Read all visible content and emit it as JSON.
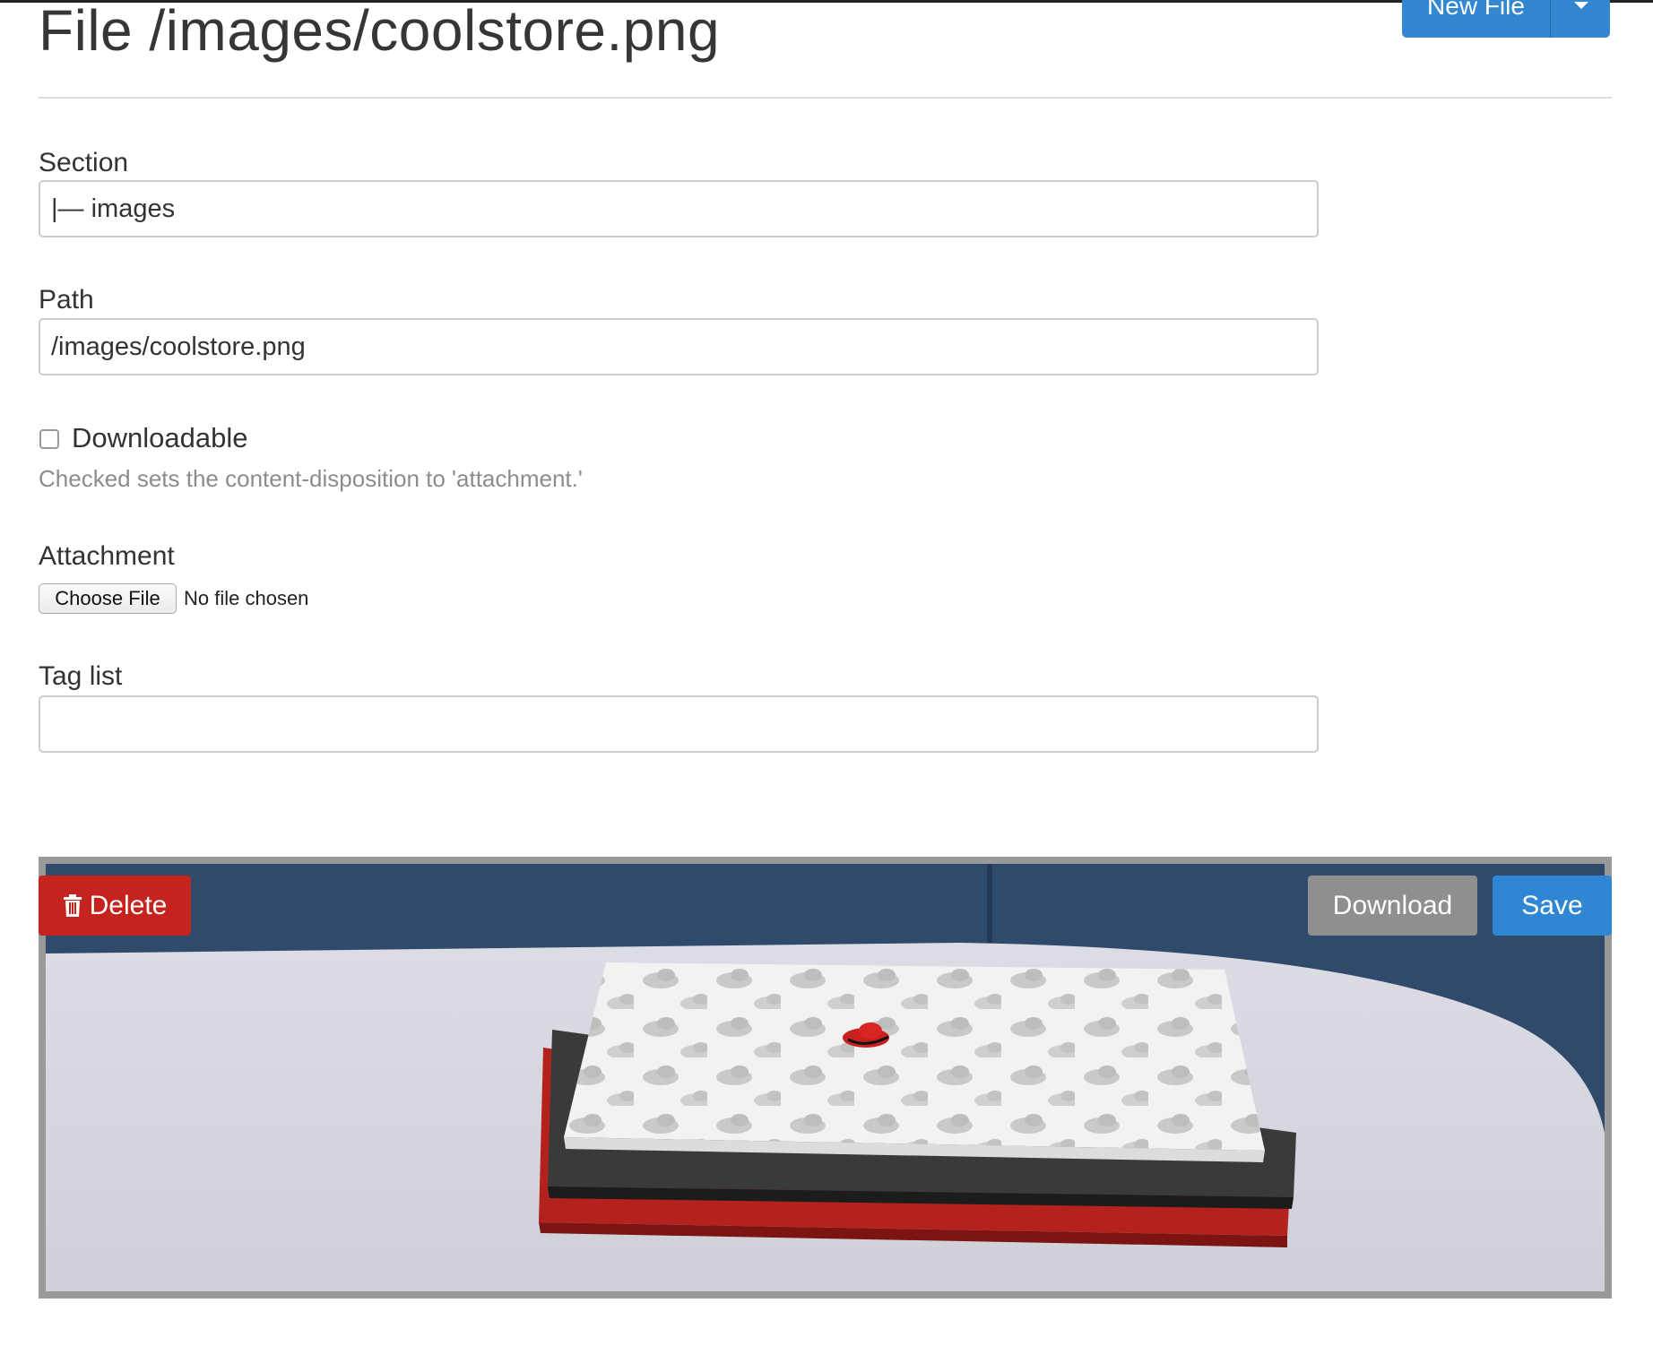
{
  "header": {
    "title": "File /images/coolstore.png",
    "new_file_label": "New File"
  },
  "form": {
    "section": {
      "label": "Section",
      "value": "|— images"
    },
    "path": {
      "label": "Path",
      "value": "/images/coolstore.png"
    },
    "downloadable": {
      "label": "Downloadable",
      "checked": false,
      "help": "Checked sets the content-disposition to 'attachment.'"
    },
    "attachment": {
      "label": "Attachment",
      "choose_file_label": "Choose File",
      "status": "No file chosen"
    },
    "tag_list": {
      "label": "Tag list",
      "value": ""
    }
  },
  "actions": {
    "delete_label": "Delete",
    "download_label": "Download",
    "save_label": "Save"
  },
  "icons": {
    "trash": "trash-icon",
    "caret": "chevron-down-icon"
  },
  "colors": {
    "primary": "#3387d0",
    "danger": "#c4231e",
    "neutral": "#8f8f8f"
  }
}
